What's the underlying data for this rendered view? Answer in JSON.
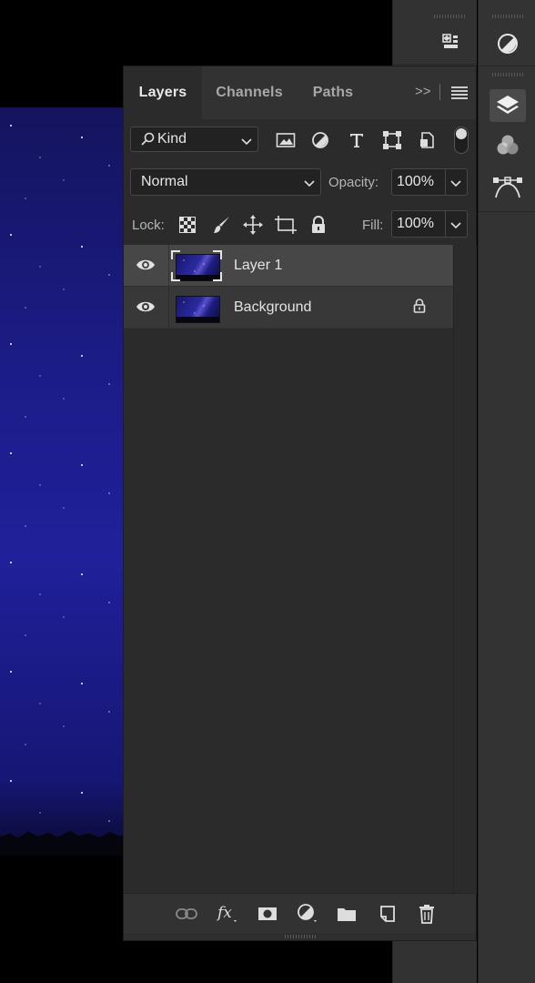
{
  "tabs": [
    {
      "label": "Layers",
      "active": true
    },
    {
      "label": "Channels",
      "active": false
    },
    {
      "label": "Paths",
      "active": false
    }
  ],
  "tab_overflow": ">>",
  "filter": {
    "kind_label": "Kind",
    "icons": [
      "pixel-layer-filter-icon",
      "adjustment-layer-filter-icon",
      "type-layer-filter-icon",
      "shape-layer-filter-icon",
      "smart-object-filter-icon"
    ]
  },
  "blend": {
    "mode": "Normal",
    "opacity_label": "Opacity:",
    "opacity": "100%"
  },
  "lock": {
    "label": "Lock:",
    "icons": [
      "lock-transparent-pixels-icon",
      "lock-image-pixels-icon",
      "lock-position-icon",
      "lock-artboard-icon",
      "lock-all-icon"
    ],
    "fill_label": "Fill:",
    "fill": "100%"
  },
  "layers": [
    {
      "name": "Layer 1",
      "selected": true,
      "visible": true,
      "locked": false
    },
    {
      "name": "Background",
      "selected": false,
      "visible": true,
      "locked": true
    }
  ],
  "footer_icons": [
    "link-layers-icon",
    "fx-layer-style-icon",
    "add-mask-icon",
    "new-adjustment-layer-icon",
    "new-group-icon",
    "new-layer-icon",
    "delete-layer-icon"
  ],
  "dock": {
    "left": [
      "properties-panel-icon"
    ],
    "right": [
      "adjustments-icon",
      "layers-panel-icon",
      "channels-icon",
      "paths-icon"
    ]
  },
  "colors": {
    "panel_bg": "#2b2b2b",
    "selected_row": "#474747",
    "canvas": "#1c1c88"
  }
}
